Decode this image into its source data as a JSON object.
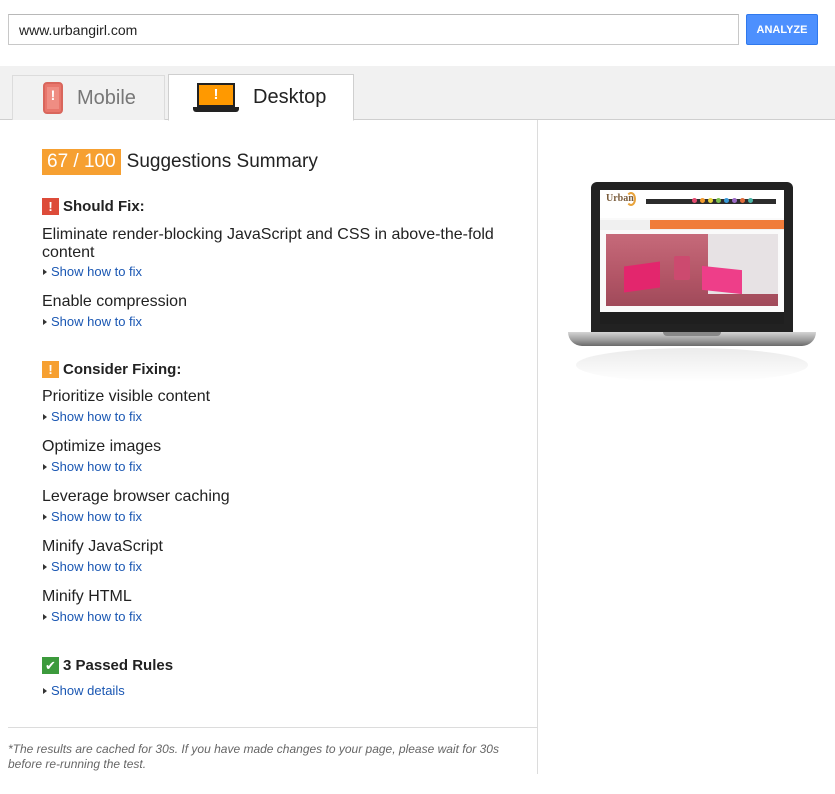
{
  "search": {
    "value": "www.urbangirl.com"
  },
  "analyze_label": "ANALYZE",
  "tabs": {
    "mobile": {
      "label": "Mobile",
      "icon": "mobile-warning-icon"
    },
    "desktop": {
      "label": "Desktop",
      "icon": "desktop-warning-icon"
    }
  },
  "summary": {
    "score": "67 / 100",
    "title": "Suggestions Summary",
    "score_color": "#f6a031"
  },
  "should_fix": {
    "heading": "Should Fix:",
    "icon": "!",
    "items": [
      {
        "title": "Eliminate render-blocking JavaScript and CSS in above-the-fold content",
        "link": "Show how to fix"
      },
      {
        "title": "Enable compression",
        "link": "Show how to fix"
      }
    ]
  },
  "consider_fixing": {
    "heading": "Consider Fixing:",
    "icon": "!",
    "items": [
      {
        "title": "Prioritize visible content",
        "link": "Show how to fix"
      },
      {
        "title": "Optimize images",
        "link": "Show how to fix"
      },
      {
        "title": "Leverage browser caching",
        "link": "Show how to fix"
      },
      {
        "title": "Minify JavaScript",
        "link": "Show how to fix"
      },
      {
        "title": "Minify HTML",
        "link": "Show how to fix"
      }
    ]
  },
  "passed": {
    "heading": "3 Passed Rules",
    "icon": "✔",
    "link": "Show details"
  },
  "footnote": "*The results are cached for 30s. If you have made changes to your page, please wait for 30s before re-running the test.",
  "colors": {
    "accent_blue": "#4d90fe",
    "link": "#1a57b3",
    "warning_red": "#dd4b39",
    "warning_orange": "#f6a031",
    "pass_green": "#3c9a3c"
  }
}
